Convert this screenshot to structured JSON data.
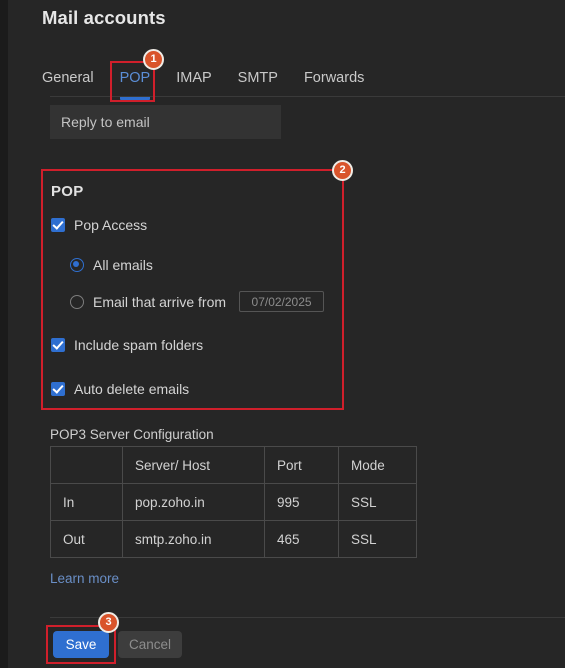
{
  "header": {
    "title": "Mail accounts"
  },
  "tabs": [
    {
      "label": "General",
      "active": false
    },
    {
      "label": "POP",
      "active": true
    },
    {
      "label": "IMAP",
      "active": false
    },
    {
      "label": "SMTP",
      "active": false
    },
    {
      "label": "Forwards",
      "active": false
    }
  ],
  "reply_field": {
    "label": "Reply to email"
  },
  "pop_section": {
    "heading": "POP",
    "pop_access": {
      "label": "Pop Access",
      "checked": true
    },
    "radio_all": {
      "label": "All emails",
      "selected": true
    },
    "radio_arrive": {
      "label": "Email that arrive from",
      "selected": false
    },
    "date_value": "07/02/2025",
    "include_spam": {
      "label": "Include spam folders",
      "checked": true
    },
    "auto_delete": {
      "label": "Auto delete emails",
      "checked": true
    }
  },
  "server_table": {
    "label": "POP3 Server Configuration",
    "headers": [
      "",
      "Server/ Host",
      "Port",
      "Mode"
    ],
    "rows": [
      [
        "In",
        "pop.zoho.in",
        "995",
        "SSL"
      ],
      [
        "Out",
        "smtp.zoho.in",
        "465",
        "SSL"
      ]
    ]
  },
  "learn_more": "Learn more",
  "footer": {
    "save_label": "Save",
    "cancel_label": "Cancel"
  },
  "annotations": {
    "badge1": "1",
    "badge2": "2",
    "badge3": "3"
  },
  "colors": {
    "accent_blue": "#2f6fd0",
    "annotation_red": "#d01f2b",
    "badge_orange": "#d9542b",
    "link_blue": "#6a8fc7",
    "background": "#262626"
  }
}
